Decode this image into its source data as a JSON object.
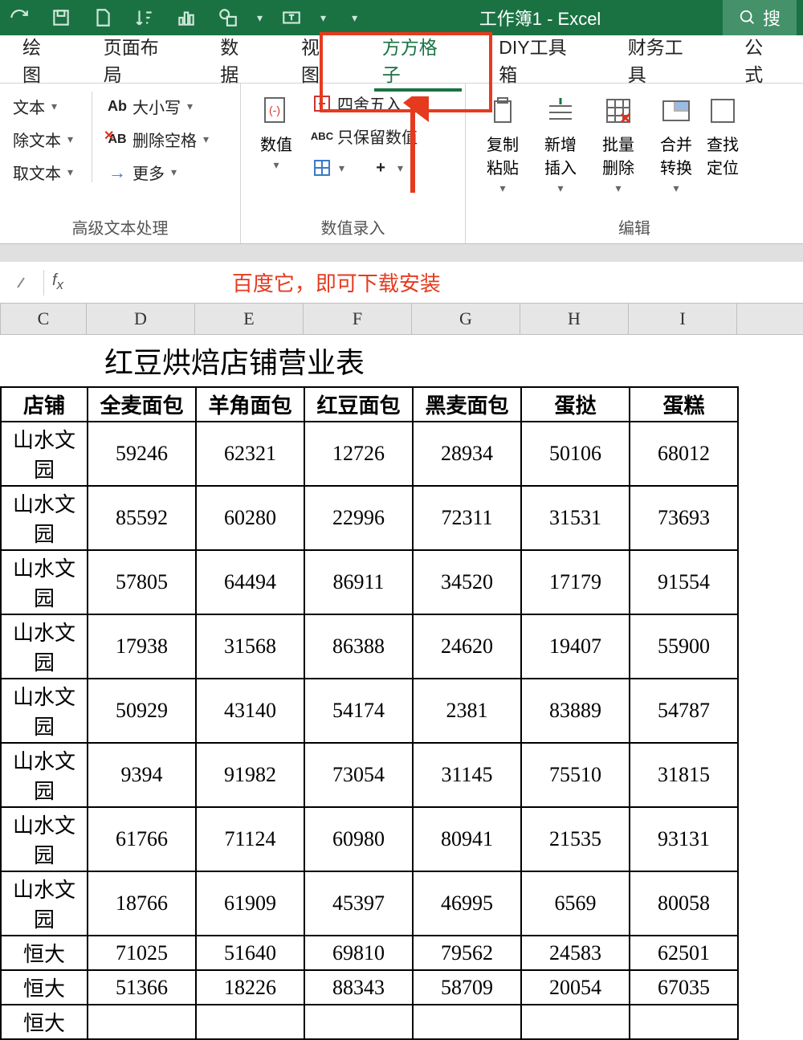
{
  "title": "工作簿1 - Excel",
  "search": "搜",
  "tabs": [
    "绘图",
    "页面布局",
    "数据",
    "视图",
    "方方格子",
    "DIY工具箱",
    "财务工具",
    "公式"
  ],
  "active_tab_index": 4,
  "ribbon": {
    "group1": {
      "label": "高级文本处理",
      "items": [
        "文本",
        "除文本",
        "取文本"
      ],
      "col2": [
        "大小写",
        "删除空格",
        "更多"
      ],
      "ab_prefix": "Ab",
      "xab_prefix": "AB",
      "arrow_prefix": "→"
    },
    "group2": {
      "label": "数值录入",
      "big": "数值",
      "items": [
        "四舍五入",
        "只保留数值"
      ],
      "abc_prefix": "ABC"
    },
    "group3": {
      "label": "编辑",
      "items": [
        "复制粘贴",
        "新增插入",
        "批量删除",
        "合并转换",
        "查找定位"
      ]
    }
  },
  "formula_bar": "百度它，即可下载安装",
  "columns": [
    "C",
    "D",
    "E",
    "F",
    "G",
    "H",
    "I"
  ],
  "sheet_title": "红豆烘焙店铺营业表",
  "headers": [
    "店铺",
    "全麦面包",
    "羊角面包",
    "红豆面包",
    "黑麦面包",
    "蛋挞",
    "蛋糕"
  ],
  "rows": [
    [
      "山水文园",
      59246,
      62321,
      12726,
      28934,
      50106,
      68012
    ],
    [
      "山水文园",
      85592,
      60280,
      22996,
      72311,
      31531,
      73693
    ],
    [
      "山水文园",
      57805,
      64494,
      86911,
      34520,
      17179,
      91554
    ],
    [
      "山水文园",
      17938,
      31568,
      86388,
      24620,
      19407,
      55900
    ],
    [
      "山水文园",
      50929,
      43140,
      54174,
      2381,
      83889,
      54787
    ],
    [
      "山水文园",
      9394,
      91982,
      73054,
      31145,
      75510,
      31815
    ],
    [
      "山水文园",
      61766,
      71124,
      60980,
      80941,
      21535,
      93131
    ],
    [
      "山水文园",
      18766,
      61909,
      45397,
      46995,
      6569,
      80058
    ],
    [
      "恒大",
      71025,
      51640,
      69810,
      79562,
      24583,
      62501
    ],
    [
      "恒大",
      51366,
      18226,
      88343,
      58709,
      20054,
      67035
    ],
    [
      "恒大",
      "",
      "",
      "",
      "",
      "",
      ""
    ]
  ]
}
